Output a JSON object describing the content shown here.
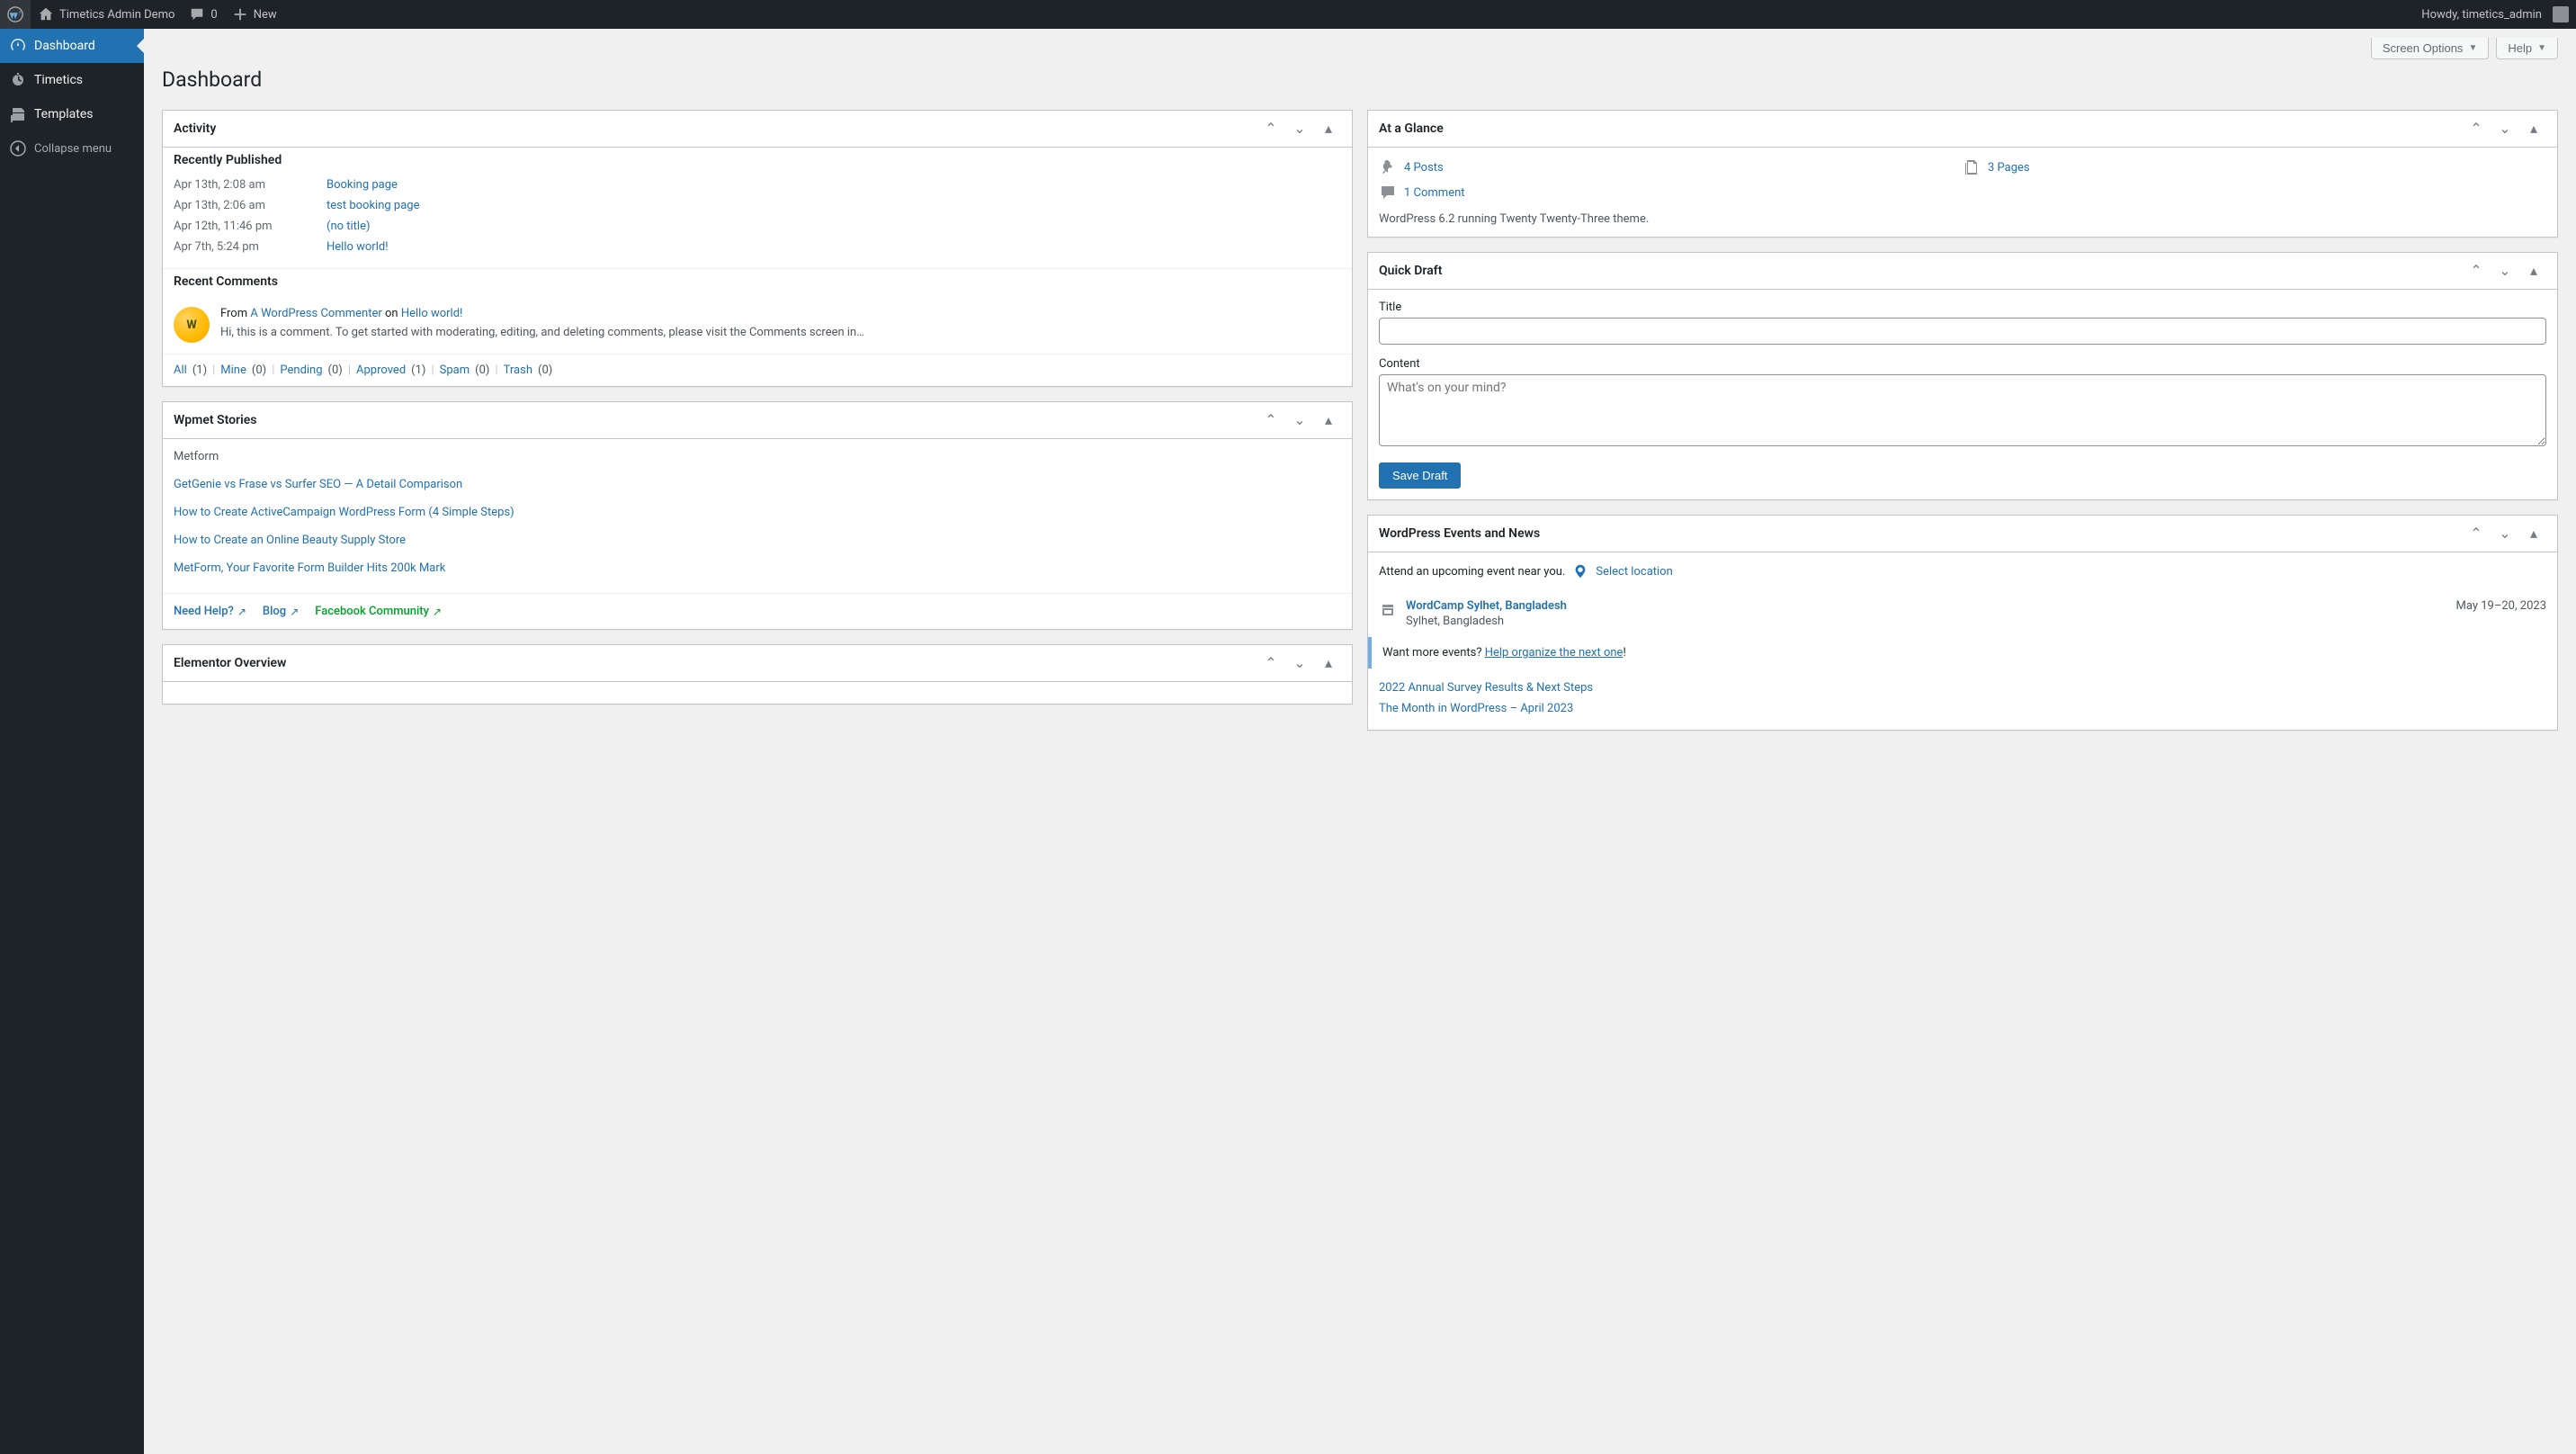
{
  "adminbar": {
    "site_name": "Timetics Admin Demo",
    "comments_count": "0",
    "new_label": "New",
    "howdy": "Howdy, timetics_admin"
  },
  "sidebar": {
    "items": [
      {
        "label": "Dashboard"
      },
      {
        "label": "Timetics"
      },
      {
        "label": "Templates"
      },
      {
        "label": "Collapse menu"
      }
    ]
  },
  "topbar": {
    "screen_options": "Screen Options",
    "help": "Help"
  },
  "page_title": "Dashboard",
  "activity": {
    "title": "Activity",
    "recently_published": "Recently Published",
    "posts": [
      {
        "date": "Apr 13th, 2:08 am",
        "title": "Booking page"
      },
      {
        "date": "Apr 13th, 2:06 am",
        "title": "test booking page"
      },
      {
        "date": "Apr 12th, 11:46 pm",
        "title": "(no title)"
      },
      {
        "date": "Apr 7th, 5:24 pm",
        "title": "Hello world!"
      }
    ],
    "recent_comments": "Recent Comments",
    "comment": {
      "from_label": "From",
      "author": "A WordPress Commenter",
      "on_label": "on",
      "post": "Hello world!",
      "excerpt": "Hi, this is a comment. To get started with moderating, editing, and deleting comments, please visit the Comments screen in…"
    },
    "filters": [
      {
        "label": "All",
        "count": "(1)"
      },
      {
        "label": "Mine",
        "count": "(0)"
      },
      {
        "label": "Pending",
        "count": "(0)"
      },
      {
        "label": "Approved",
        "count": "(1)"
      },
      {
        "label": "Spam",
        "count": "(0)"
      },
      {
        "label": "Trash",
        "count": "(0)"
      }
    ]
  },
  "wpmet": {
    "title": "Wpmet Stories",
    "sub": "Metform",
    "stories": [
      "GetGenie vs Frase vs Surfer SEO — A Detail Comparison",
      "How to Create ActiveCampaign WordPress Form (4 Simple Steps)",
      "How to Create an Online Beauty Supply Store",
      "MetForm, Your Favorite Form Builder Hits 200k Mark"
    ],
    "footer": {
      "help": "Need Help?",
      "blog": "Blog",
      "fb": "Facebook Community"
    }
  },
  "elementor": {
    "title": "Elementor Overview"
  },
  "glance": {
    "title": "At a Glance",
    "posts": "4 Posts",
    "pages": "3 Pages",
    "comments": "1 Comment",
    "version": "WordPress 6.2 running Twenty Twenty-Three theme."
  },
  "quickdraft": {
    "title": "Quick Draft",
    "title_label": "Title",
    "content_label": "Content",
    "content_placeholder": "What's on your mind?",
    "save": "Save Draft"
  },
  "events": {
    "title": "WordPress Events and News",
    "attend": "Attend an upcoming event near you.",
    "select_location": "Select location",
    "event": {
      "name": "WordCamp Sylhet, Bangladesh",
      "location": "Sylhet, Bangladesh",
      "date": "May 19–20, 2023"
    },
    "want_more_prefix": "Want more events? ",
    "want_more_link": "Help organize the next one",
    "want_more_suffix": "!",
    "news": [
      "2022 Annual Survey Results & Next Steps",
      "The Month in WordPress – April 2023"
    ]
  }
}
